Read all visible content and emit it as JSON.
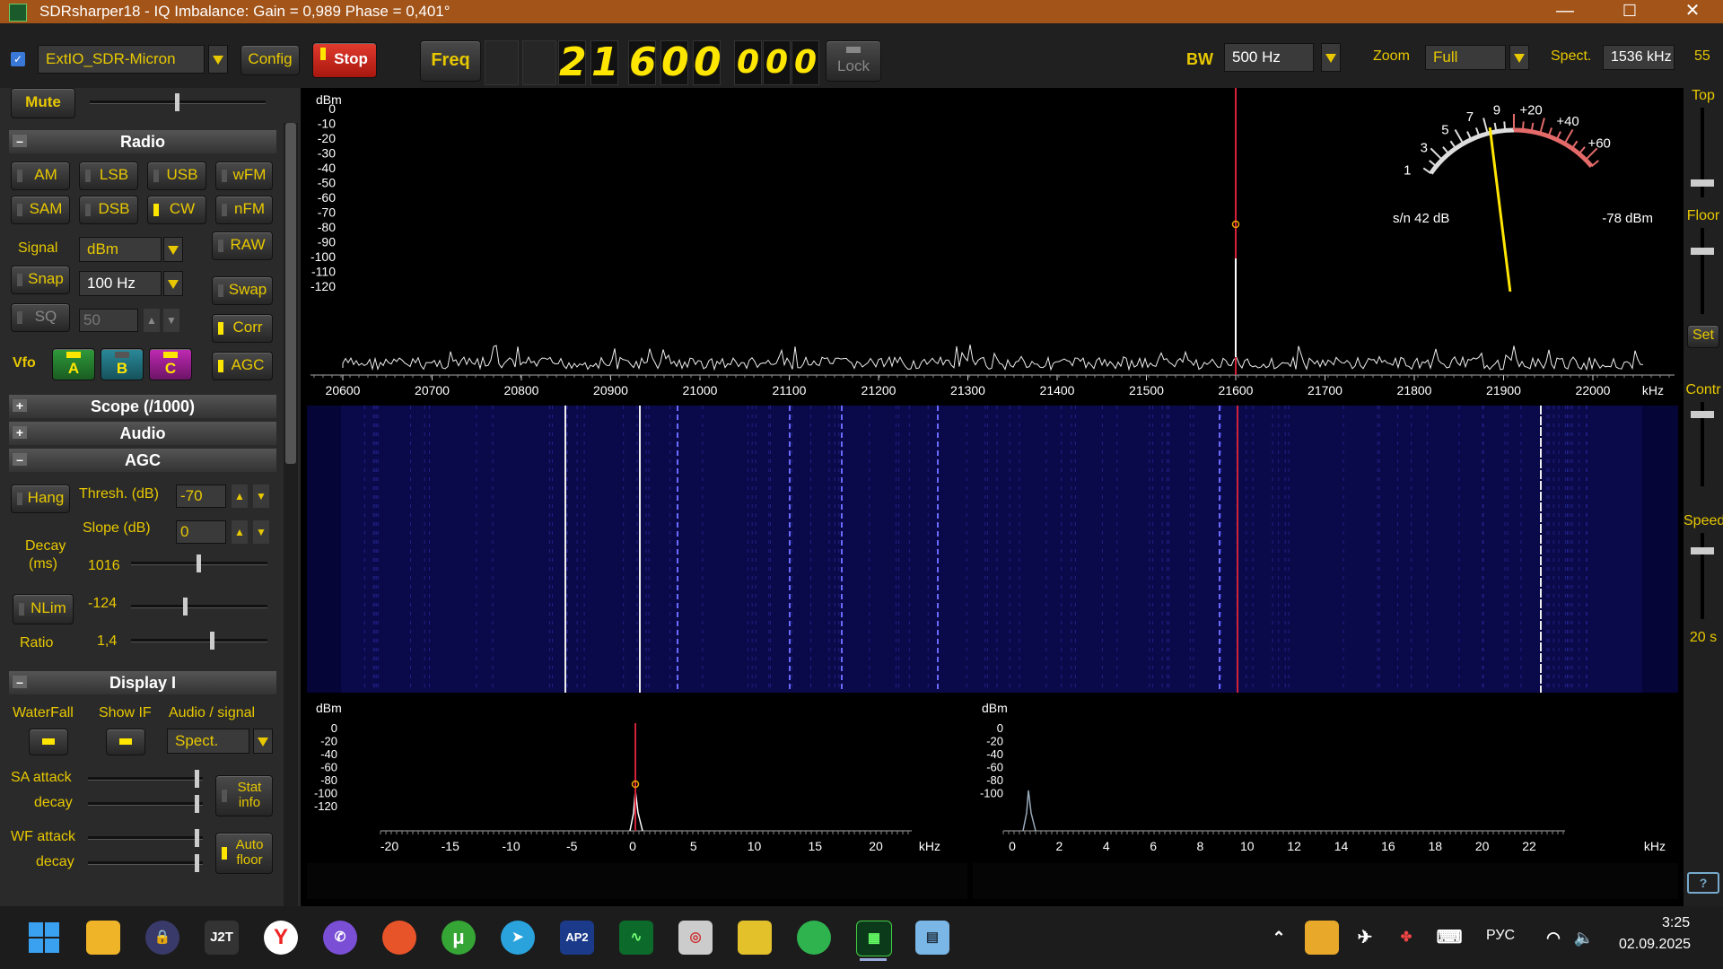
{
  "window": {
    "title": "SDRsharper18 - IQ Imbalance: Gain = 0,989 Phase = 0,401°",
    "minimize": "—",
    "maximize": "☐",
    "close": "✕"
  },
  "toolbar": {
    "device": "ExtIO_SDR-Micron",
    "config": "Config",
    "stop": "Stop",
    "freq_label": "Freq",
    "freq_digits": [
      "2",
      "1",
      "6",
      "0",
      "0",
      "0",
      "0",
      "0"
    ],
    "lock": "Lock",
    "bw_label": "BW",
    "bw_value": "500 Hz",
    "zoom_label": "Zoom",
    "zoom_value": "Full",
    "spect_label": "Spect.",
    "spect_value": "1536 kHz",
    "extra": "55"
  },
  "left": {
    "mute": "Mute",
    "radio_header": "Radio",
    "modes": [
      "AM",
      "LSB",
      "USB",
      "wFM",
      "SAM",
      "DSB",
      "CW",
      "nFM"
    ],
    "active_mode": "CW",
    "signal_label": "Signal",
    "signal_value": "dBm",
    "raw": "RAW",
    "snap": "Snap",
    "snap_value": "100 Hz",
    "swap": "Swap",
    "sq": "SQ",
    "sq_value": "50",
    "corr": "Corr",
    "vfo_label": "Vfo",
    "vfo_a": "A",
    "vfo_b": "B",
    "vfo_c": "C",
    "agc": "AGC",
    "scope_header": "Scope (/1000)",
    "audio_header": "Audio",
    "agc_header": "AGC",
    "hang": "Hang",
    "thresh_label": "Thresh. (dB)",
    "thresh_value": "-70",
    "slope_label": "Slope (dB)",
    "slope_value": "0",
    "decay_label1": "Decay",
    "decay_label2": "(ms)",
    "decay_value": "1016",
    "nlim": "NLim",
    "nlim_value": "-124",
    "ratio_label": "Ratio",
    "ratio_value": "1,4",
    "display_header": "Display I",
    "waterfall_label": "WaterFall",
    "showif_label": "Show IF",
    "audiosig_label": "Audio / signal",
    "audiosig_value": "Spect.",
    "sa_attack": "SA attack",
    "sa_decay": "decay",
    "stat1": "Stat",
    "stat2": "info",
    "wf_attack": "WF attack",
    "wf_decay": "decay",
    "auto1": "Auto",
    "auto2": "floor",
    "slider_levels": {
      "volume": 0.5,
      "decay": 0.5,
      "nlim": 0.4,
      "ratio": 0.6,
      "sa_attack": 0.95,
      "sa_decay": 0.95,
      "wf_attack": 0.95,
      "wf_decay": 0.95
    }
  },
  "right": {
    "top": "Top",
    "floor": "Floor",
    "set": "Set",
    "contr": "Contr",
    "speed": "Speed",
    "speed_value": "20 s",
    "help": "?"
  },
  "spectrum": {
    "unit": "dBm",
    "db_ticks": [
      "0",
      "-10",
      "-20",
      "-30",
      "-40",
      "-50",
      "-60",
      "-70",
      "-80",
      "-90",
      "-100",
      "-110",
      "-120"
    ],
    "freq_ticks": [
      "20600",
      "20700",
      "20800",
      "20900",
      "21000",
      "21100",
      "21200",
      "21300",
      "21400",
      "21500",
      "21600",
      "21700",
      "21800",
      "21900",
      "22000"
    ],
    "freq_unit": "kHz",
    "meter_scale": [
      "1",
      "3",
      "5",
      "7",
      "9",
      "+20",
      "+40",
      "+60"
    ],
    "sn": "s/n 42 dB",
    "level": "-78 dBm"
  },
  "ifscope": {
    "unit": "dBm",
    "db_ticks": [
      "0",
      "-20",
      "-40",
      "-60",
      "-80",
      "-100",
      "-120"
    ],
    "x_ticks": [
      "-20",
      "-15",
      "-10",
      "-5",
      "0",
      "5",
      "10",
      "15",
      "20"
    ],
    "x_unit": "kHz"
  },
  "audioscope": {
    "unit": "dBm",
    "db_ticks": [
      "0",
      "-20",
      "-40",
      "-60",
      "-80",
      "-100"
    ],
    "x_ticks": [
      "0",
      "2",
      "4",
      "6",
      "8",
      "10",
      "12",
      "14",
      "16",
      "18",
      "20",
      "22"
    ],
    "x_unit": "kHz"
  },
  "taskbar": {
    "lang": "РУС",
    "time": "3:25",
    "date": "02.09.2025",
    "j2t": "J2T",
    "ap2": "AP2"
  }
}
